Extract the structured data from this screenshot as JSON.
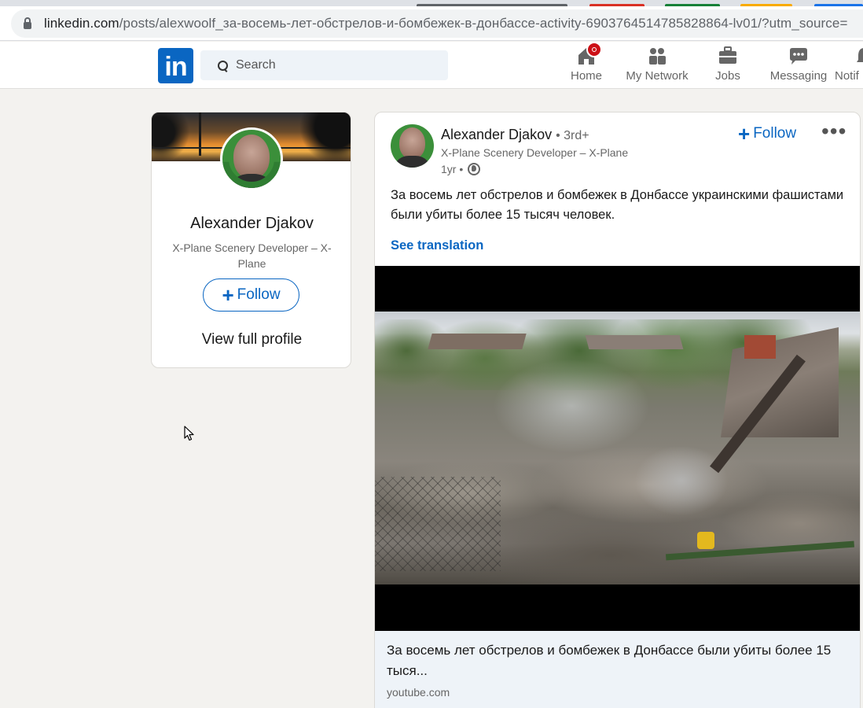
{
  "browser": {
    "url_host": "linkedin.com",
    "url_path": "/posts/alexwoolf_за-восемь-лет-обстрелов-и-бомбежек-в-донбассе-activity-6903764514785828864-lv01/?utm_source="
  },
  "nav": {
    "logo": "in",
    "search_placeholder": "Search",
    "items": [
      {
        "label": "Home"
      },
      {
        "label": "My Network"
      },
      {
        "label": "Jobs"
      },
      {
        "label": "Messaging"
      },
      {
        "label": "Notif"
      }
    ]
  },
  "profile_card": {
    "name": "Alexander Djakov",
    "headline": "X-Plane Scenery Developer – X-Plane",
    "follow_label": "Follow",
    "view_profile_label": "View full profile"
  },
  "post": {
    "author_name": "Alexander Djakov",
    "degree": "• 3rd+",
    "author_headline": "X-Plane Scenery Developer – X-Plane",
    "time": "1yr •",
    "follow_label": "Follow",
    "more_label": "•••",
    "text": "За восемь лет обстрелов и бомбежек в Донбассе украинскими фашистами были убиты более 15 тысяч человек.",
    "see_translation": "See translation",
    "link_title": "За восемь лет обстрелов и бомбежек в Донбассе были убиты более 15 тыся...",
    "link_source": "youtube.com"
  },
  "colors": {
    "brand": "#0a66c2",
    "background": "#f3f2ef",
    "badge": "#cc1016"
  }
}
